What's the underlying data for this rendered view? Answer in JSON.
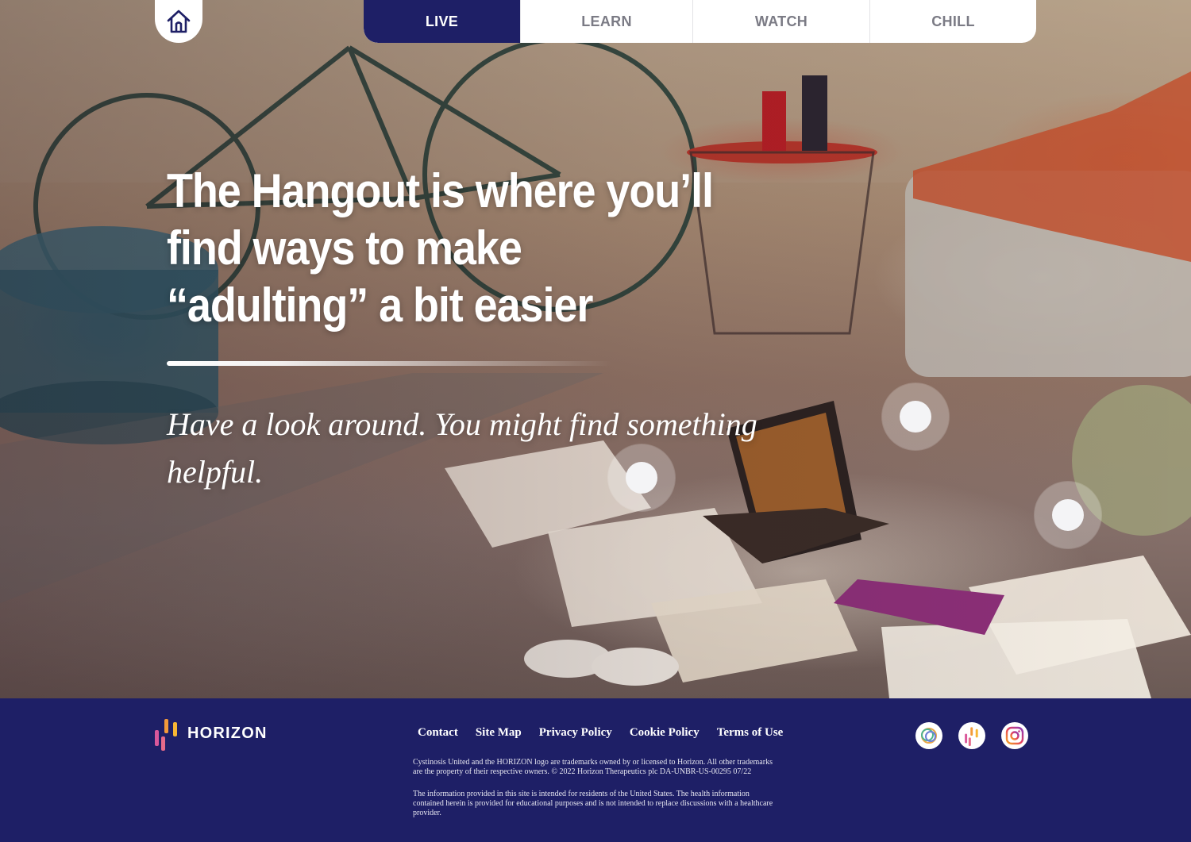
{
  "nav": {
    "home_icon": "home-icon",
    "tabs": [
      {
        "label": "LIVE",
        "active": true
      },
      {
        "label": "LEARN",
        "active": false
      },
      {
        "label": "WATCH",
        "active": false
      },
      {
        "label": "CHILL",
        "active": false
      }
    ]
  },
  "hero": {
    "headline": "The Hangout is where you’ll find ways to make “adulting” a bit easier",
    "subline": "Have a look around. You might find something helpful."
  },
  "footer": {
    "logo_text": "HORIZON",
    "links": [
      "Contact",
      "Site Map",
      "Privacy Policy",
      "Cookie Policy",
      "Terms of Use"
    ],
    "legal_1": "Cystinosis United and the HORIZON logo are trademarks owned by or licensed to Horizon. All other trademarks are the property of their respective owners. © 2022 Horizon Therapeutics plc DA-UNBR-US-00295 07/22",
    "legal_2": "The information provided in this site is intended for residents of the United States. The health information contained herein is provided for educational purposes and is not intended to replace discussions with a healthcare provider.",
    "social": [
      "cystinosis-united-icon",
      "horizon-icon",
      "instagram-icon"
    ]
  },
  "colors": {
    "brand_navy": "#1e1f66",
    "tab_inactive_text": "#7b7b85",
    "white": "#ffffff"
  }
}
